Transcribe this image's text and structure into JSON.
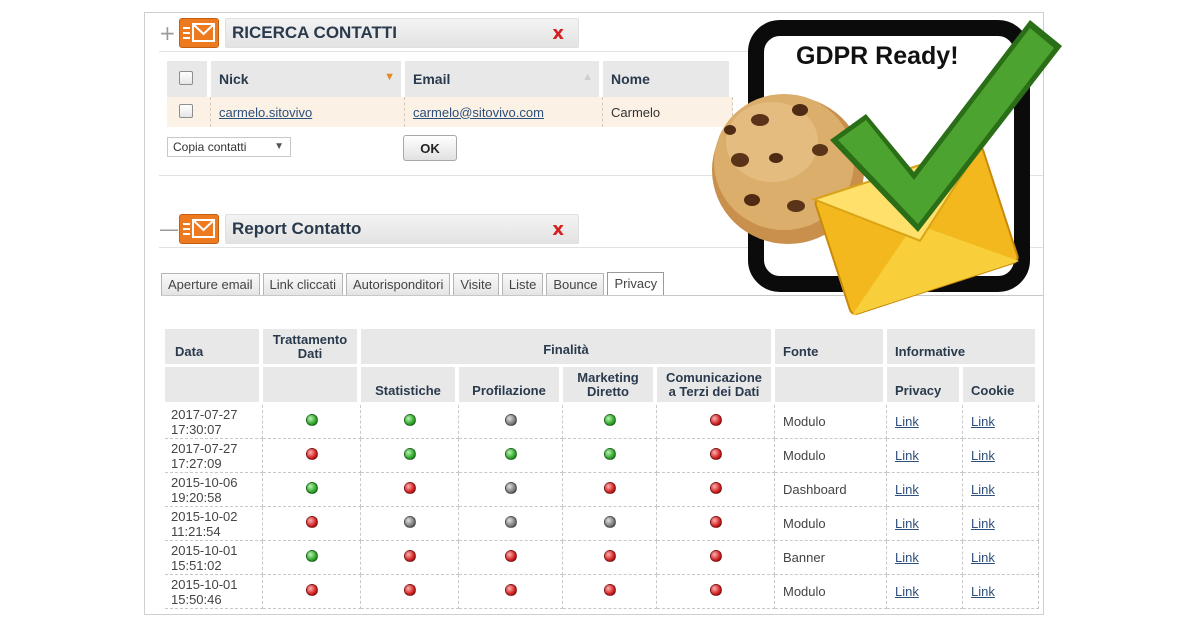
{
  "search_panel": {
    "toggle": "+",
    "title": "RICERCA CONTATTI",
    "close": "x",
    "columns": [
      "Nick",
      "Email",
      "Nome"
    ],
    "rows": [
      {
        "nick": "carmelo.sitovivo",
        "email": "carmelo@sitovivo.com",
        "nome": "Carmelo"
      }
    ],
    "action_select": "Copia contatti",
    "ok_label": "OK"
  },
  "report_panel": {
    "toggle": "—",
    "title": "Report Contatto",
    "close": "x",
    "tabs": [
      "Aperture email",
      "Link cliccati",
      "Autorisponditori",
      "Visite",
      "Liste",
      "Bounce",
      "Privacy"
    ],
    "active_tab": "Privacy",
    "headers": {
      "data": "Data",
      "trattamento": "Trattamento Dati",
      "finalita": "Finalità",
      "fonte": "Fonte",
      "informative": "Informative",
      "statistiche": "Statistiche",
      "profilazione": "Profilazione",
      "marketing": "Marketing Diretto",
      "comunicazione": "Comunicazione a Terzi dei Dati",
      "privacy": "Privacy",
      "cookie": "Cookie"
    },
    "rows": [
      {
        "date": "2017-07-27",
        "time": "17:30:07",
        "trattamento": "green",
        "statistiche": "green",
        "profilazione": "grey",
        "marketing": "green",
        "comunicazione": "red",
        "fonte": "Modulo",
        "privacy": "Link",
        "cookie": "Link"
      },
      {
        "date": "2017-07-27",
        "time": "17:27:09",
        "trattamento": "red",
        "statistiche": "green",
        "profilazione": "green",
        "marketing": "green",
        "comunicazione": "red",
        "fonte": "Modulo",
        "privacy": "Link",
        "cookie": "Link"
      },
      {
        "date": "2015-10-06",
        "time": "19:20:58",
        "trattamento": "green",
        "statistiche": "red",
        "profilazione": "grey",
        "marketing": "red",
        "comunicazione": "red",
        "fonte": "Dashboard",
        "privacy": "Link",
        "cookie": "Link"
      },
      {
        "date": "2015-10-02",
        "time": "11:21:54",
        "trattamento": "red",
        "statistiche": "grey",
        "profilazione": "grey",
        "marketing": "grey",
        "comunicazione": "red",
        "fonte": "Modulo",
        "privacy": "Link",
        "cookie": "Link"
      },
      {
        "date": "2015-10-01",
        "time": "15:51:02",
        "trattamento": "green",
        "statistiche": "red",
        "profilazione": "red",
        "marketing": "red",
        "comunicazione": "red",
        "fonte": "Banner",
        "privacy": "Link",
        "cookie": "Link"
      },
      {
        "date": "2015-10-01",
        "time": "15:50:46",
        "trattamento": "red",
        "statistiche": "red",
        "profilazione": "red",
        "marketing": "red",
        "comunicazione": "red",
        "fonte": "Modulo",
        "privacy": "Link",
        "cookie": "Link"
      }
    ]
  },
  "badge": {
    "text": "GDPR Ready!",
    "icons": [
      "cookie-icon",
      "envelope-icon",
      "checkmark-icon"
    ]
  },
  "colors": {
    "accent_orange": "#ee7a1f",
    "close_red": "#d42020",
    "status_green": "#2ea52a",
    "status_red": "#d12020",
    "status_grey": "#7a7a7a",
    "check_green": "#3f9a2a",
    "envelope_yellow": "#f7c62a"
  }
}
